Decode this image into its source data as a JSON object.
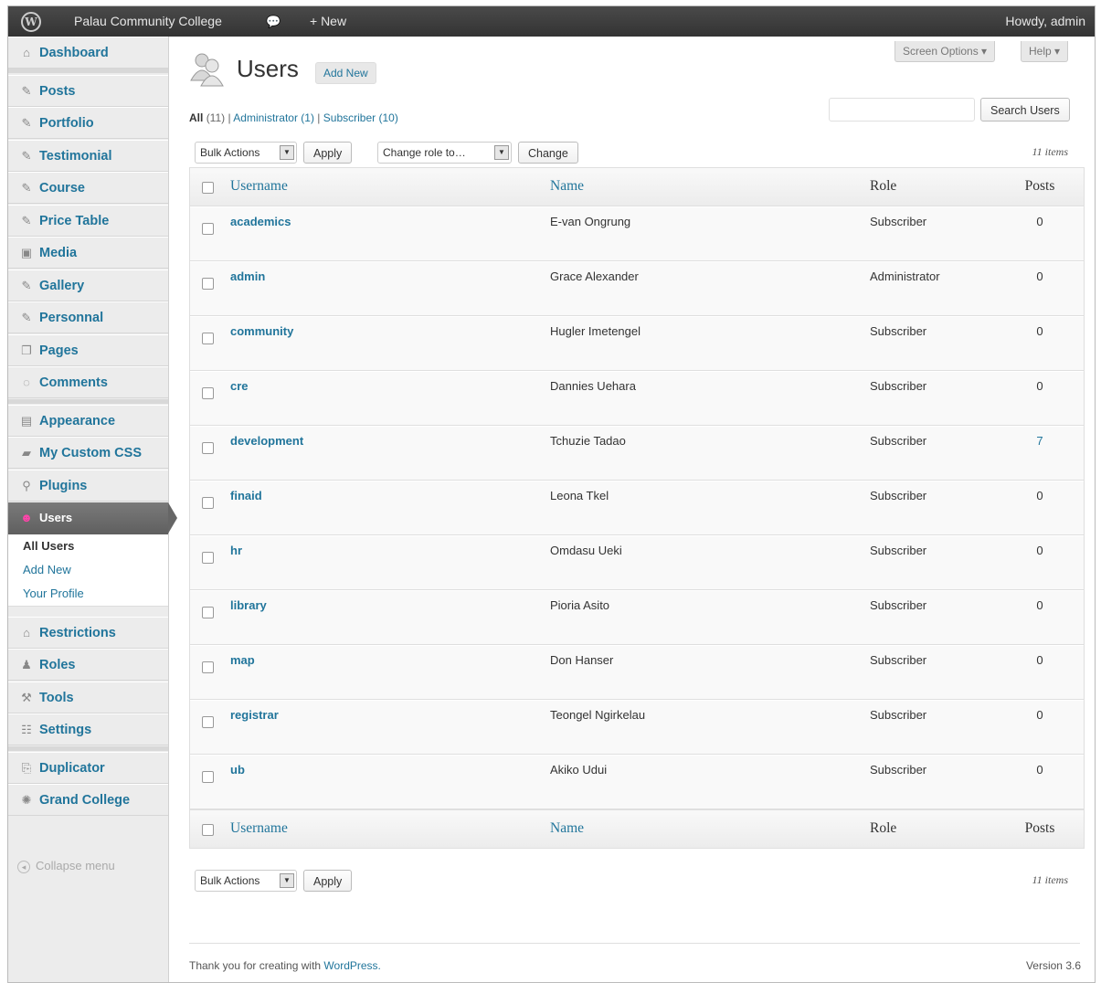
{
  "admin_bar": {
    "site_name": "Palau Community College",
    "comment_icon": "comment-bubble-icon",
    "new_label": "+ New",
    "howdy": "Howdy, admin"
  },
  "sidebar": {
    "items": [
      {
        "label": "Dashboard",
        "icon": "home-icon",
        "glyph": "⌂"
      },
      {
        "label": "Posts",
        "icon": "pin-icon",
        "glyph": "✎"
      },
      {
        "label": "Portfolio",
        "icon": "pin-icon",
        "glyph": "✎"
      },
      {
        "label": "Testimonial",
        "icon": "pin-icon",
        "glyph": "✎"
      },
      {
        "label": "Course",
        "icon": "pin-icon",
        "glyph": "✎"
      },
      {
        "label": "Price Table",
        "icon": "pin-icon",
        "glyph": "✎"
      },
      {
        "label": "Media",
        "icon": "media-icon",
        "glyph": "▣"
      },
      {
        "label": "Gallery",
        "icon": "pin-icon",
        "glyph": "✎"
      },
      {
        "label": "Personnal",
        "icon": "pin-icon",
        "glyph": "✎"
      },
      {
        "label": "Pages",
        "icon": "pages-icon",
        "glyph": "❐"
      },
      {
        "label": "Comments",
        "icon": "comments-icon",
        "glyph": "◌"
      },
      {
        "label": "Appearance",
        "icon": "appearance-icon",
        "glyph": "▤"
      },
      {
        "label": "My Custom CSS",
        "icon": "css-icon",
        "glyph": "▰"
      },
      {
        "label": "Plugins",
        "icon": "plugins-icon",
        "glyph": "⚲"
      },
      {
        "label": "Users",
        "icon": "users-icon",
        "glyph": "☻"
      },
      {
        "label": "Restrictions",
        "icon": "lock-icon",
        "glyph": "⌂"
      },
      {
        "label": "Roles",
        "icon": "person-icon",
        "glyph": "♟"
      },
      {
        "label": "Tools",
        "icon": "tools-icon",
        "glyph": "⚒"
      },
      {
        "label": "Settings",
        "icon": "settings-icon",
        "glyph": "☷"
      },
      {
        "label": "Duplicator",
        "icon": "duplicator-icon",
        "glyph": "⎘"
      },
      {
        "label": "Grand College",
        "icon": "gear-icon",
        "glyph": "✺"
      }
    ],
    "submenu": [
      "All Users",
      "Add New",
      "Your Profile"
    ],
    "collapse": "Collapse menu"
  },
  "header": {
    "title": "Users",
    "add_new": "Add New",
    "screen_options": "Screen Options ▾",
    "help": "Help ▾"
  },
  "filters": {
    "all": "All",
    "all_count": "(11)",
    "administrator": "Administrator",
    "administrator_count": "(1)",
    "subscriber": "Subscriber",
    "subscriber_count": "(10)"
  },
  "search": {
    "button": "Search Users",
    "value": ""
  },
  "actions": {
    "bulk": "Bulk Actions",
    "apply": "Apply",
    "change_role": "Change role to…",
    "change": "Change",
    "items_count": "11 items"
  },
  "table": {
    "columns": {
      "username": "Username",
      "name": "Name",
      "role": "Role",
      "posts": "Posts"
    },
    "rows": [
      {
        "username": "academics",
        "name": "E-van Ongrung",
        "role": "Subscriber",
        "posts": "0"
      },
      {
        "username": "admin",
        "name": "Grace Alexander",
        "role": "Administrator",
        "posts": "0"
      },
      {
        "username": "community",
        "name": "Hugler Imetengel",
        "role": "Subscriber",
        "posts": "0"
      },
      {
        "username": "cre",
        "name": "Dannies Uehara",
        "role": "Subscriber",
        "posts": "0"
      },
      {
        "username": "development",
        "name": "Tchuzie Tadao",
        "role": "Subscriber",
        "posts": "7"
      },
      {
        "username": "finaid",
        "name": "Leona Tkel",
        "role": "Subscriber",
        "posts": "0"
      },
      {
        "username": "hr",
        "name": "Omdasu Ueki",
        "role": "Subscriber",
        "posts": "0"
      },
      {
        "username": "library",
        "name": "Pioria Asito",
        "role": "Subscriber",
        "posts": "0"
      },
      {
        "username": "map",
        "name": "Don Hanser",
        "role": "Subscriber",
        "posts": "0"
      },
      {
        "username": "registrar",
        "name": "Teongel Ngirkelau",
        "role": "Subscriber",
        "posts": "0"
      },
      {
        "username": "ub",
        "name": "Akiko Udui",
        "role": "Subscriber",
        "posts": "0"
      }
    ]
  },
  "footer": {
    "thanks": "Thank you for creating with",
    "wordpress": "WordPress.",
    "version": "Version 3.6"
  }
}
